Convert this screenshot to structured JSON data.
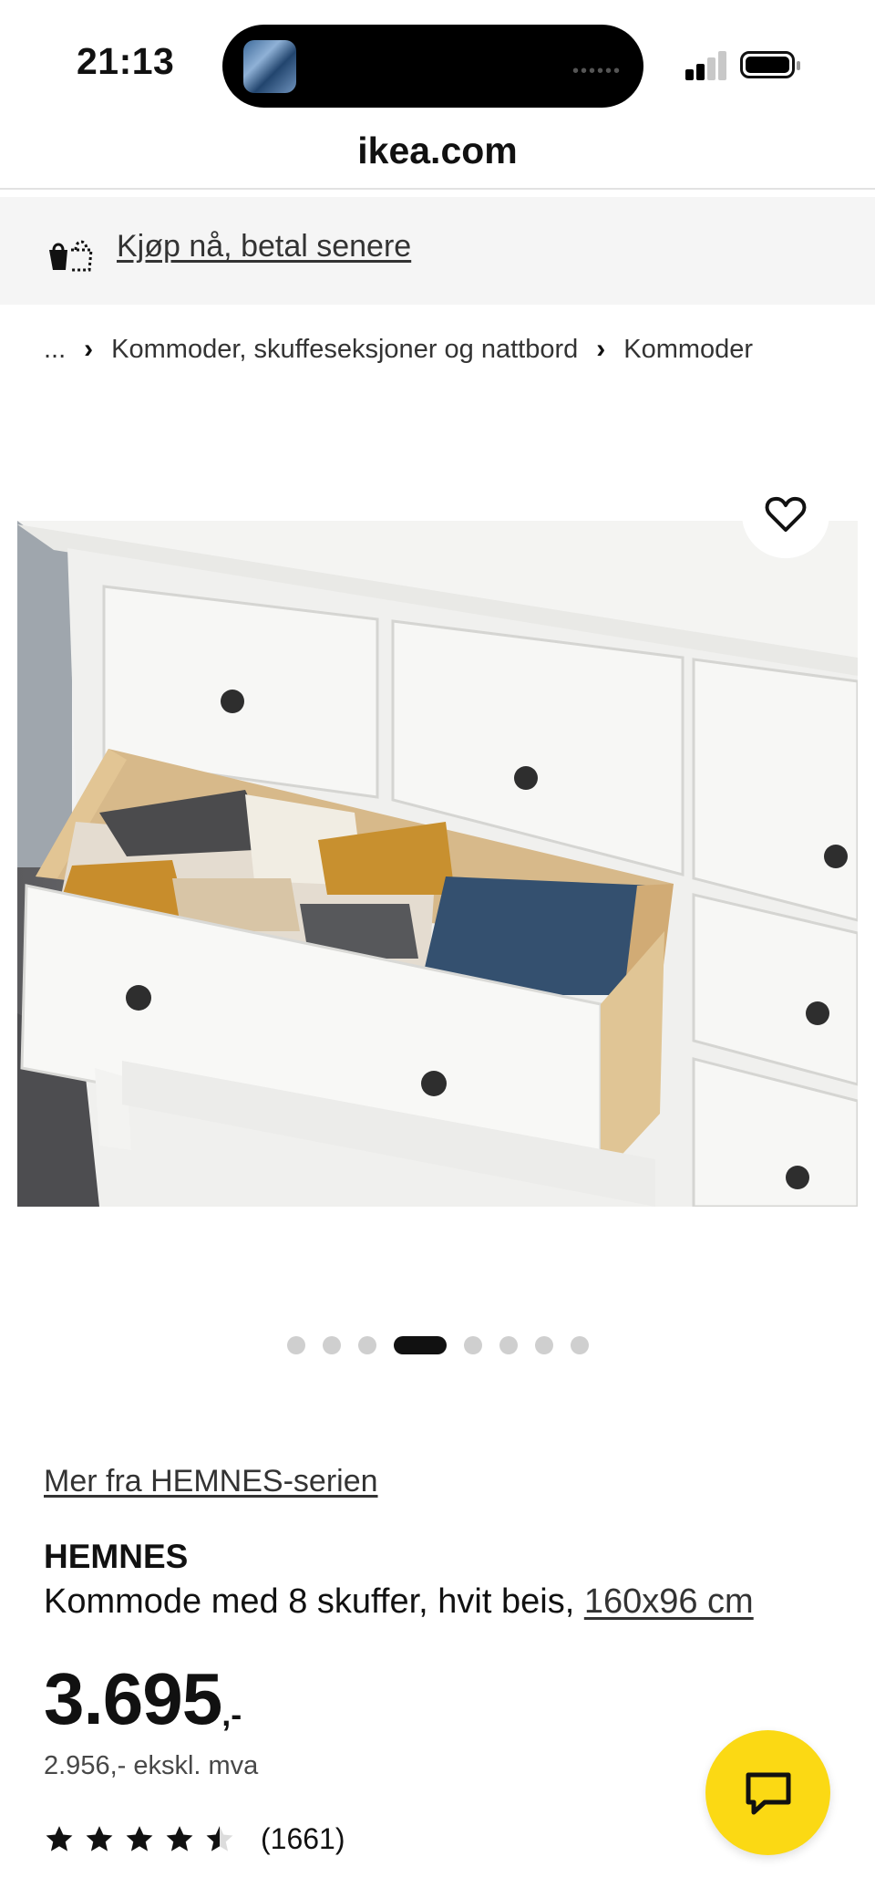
{
  "status_bar": {
    "time": "21:13"
  },
  "browser": {
    "url": "ikea.com"
  },
  "promo": {
    "link_text": "Kjøp nå, betal senere",
    "icon": "shopping-bag-installments-icon"
  },
  "breadcrumb": {
    "ellipsis": "...",
    "items": [
      "Kommoder, skuffeseksjoner og nattbord",
      "Kommoder"
    ]
  },
  "gallery": {
    "image_count": 8,
    "active_index": 3
  },
  "product": {
    "series_link": "Mer fra HEMNES-serien",
    "name": "HEMNES",
    "description": "Kommode med 8 skuffer, hvit beis, ",
    "size_link": "160x96 cm",
    "price": "3.695",
    "price_suffix": ",-",
    "price_ex_vat": "2.956,- ekskl. mva",
    "rating_value": 4.5,
    "rating_max": 5,
    "review_count": "(1661)"
  },
  "colors": {
    "chat_button": "#fbd914",
    "promo_background": "#f5f5f5",
    "dot_inactive": "#cfcfcf",
    "dot_active": "#111111"
  }
}
